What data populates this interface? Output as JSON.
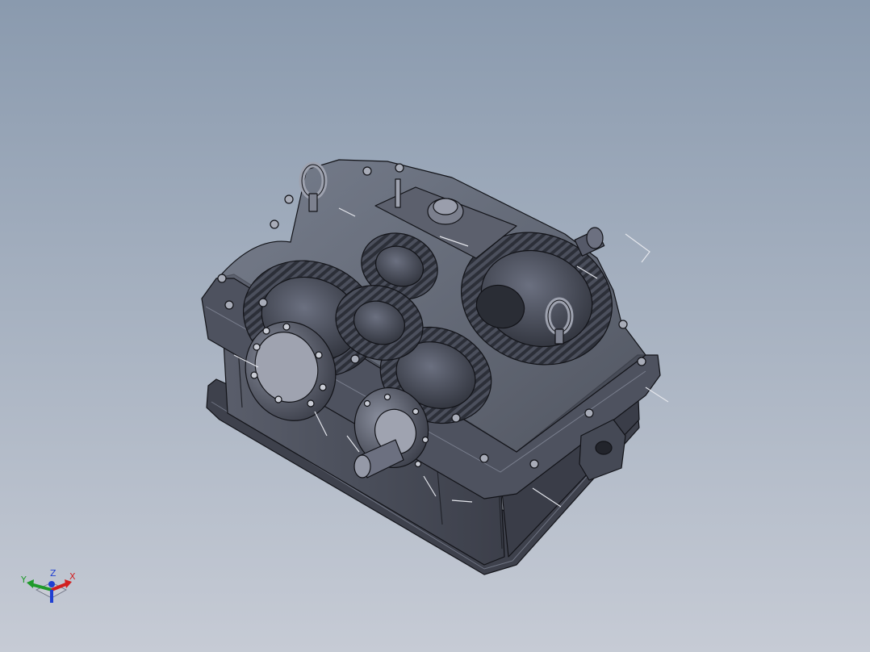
{
  "viewport": {
    "background_top": "#8a9aae",
    "background_bottom": "#c4c9d4",
    "model": "gearbox-assembly-transparent-housing",
    "model_color": "#4a4e5a",
    "edge_color": "#121318"
  },
  "triad": {
    "x_label": "X",
    "y_label": "Y",
    "z_label": "Z",
    "x_color": "#d21f1f",
    "y_color": "#1f9a2a",
    "z_color": "#1f3fd2"
  }
}
